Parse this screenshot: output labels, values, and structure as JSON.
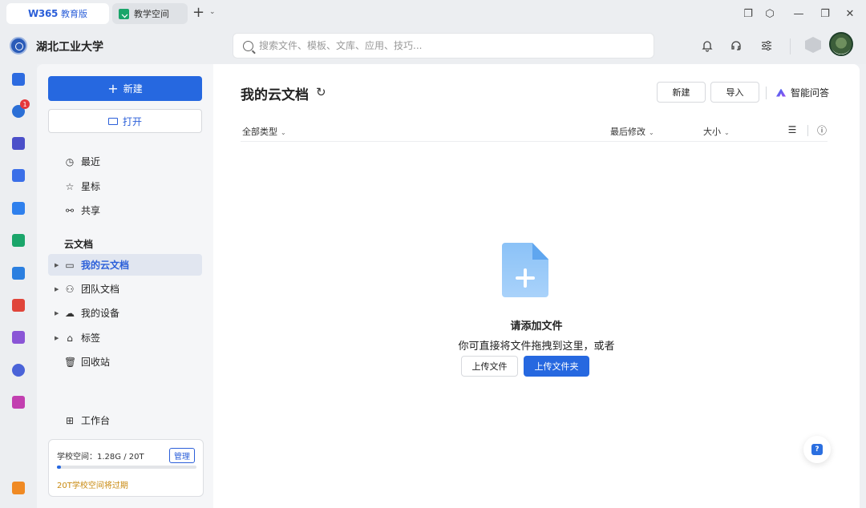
{
  "tabs": [
    {
      "brand": "W365",
      "sub": "教育版",
      "active": true
    },
    {
      "label": "教学空间",
      "active": false
    }
  ],
  "header": {
    "org_name": "湖北工业大学",
    "search_placeholder": "搜索文件、模板、文库、应用、技巧..."
  },
  "rail": {
    "badge_count": "1",
    "icon_colors": [
      "#2d6be0",
      "#2b6fd6",
      "#4b4fc9",
      "#3b6fe8",
      "#2f80ed",
      "#1aa56a",
      "#2b7fe0",
      "#e0453a",
      "#8a55d6",
      "#4a63d8",
      "#c23fb0",
      "#f08a24"
    ]
  },
  "sidebar": {
    "new_label": "新建",
    "open_label": "打开",
    "quick": [
      {
        "label": "最近",
        "icon": "clock-icon"
      },
      {
        "label": "星标",
        "icon": "star-icon"
      },
      {
        "label": "共享",
        "icon": "share-icon"
      }
    ],
    "section_cloud": "云文档",
    "cloud_items": [
      {
        "label": "我的云文档",
        "icon": "folder-icon",
        "active": true
      },
      {
        "label": "团队文档",
        "icon": "team-icon"
      },
      {
        "label": "我的设备",
        "icon": "cloud-device-icon"
      },
      {
        "label": "标签",
        "icon": "tag-icon"
      },
      {
        "label": "回收站",
        "icon": "trash-icon"
      }
    ],
    "workbench_label": "工作台",
    "storage": {
      "label": "学校空间：1.28G / 20T",
      "used_fraction": 0.03,
      "manage_label": "管理",
      "warning": "20T学校空间将过期"
    }
  },
  "main": {
    "title": "我的云文档",
    "new_label": "新建",
    "import_label": "导入",
    "ai_label": "智能问答",
    "filter_type": "全部类型",
    "sort_modified": "最后修改",
    "sort_size": "大小",
    "empty_title": "请添加文件",
    "empty_desc": "你可直接将文件拖拽到这里，或者",
    "upload_file": "上传文件",
    "upload_folder": "上传文件夹"
  },
  "colors": {
    "primary": "#2668e0",
    "warning": "#c98a10"
  }
}
